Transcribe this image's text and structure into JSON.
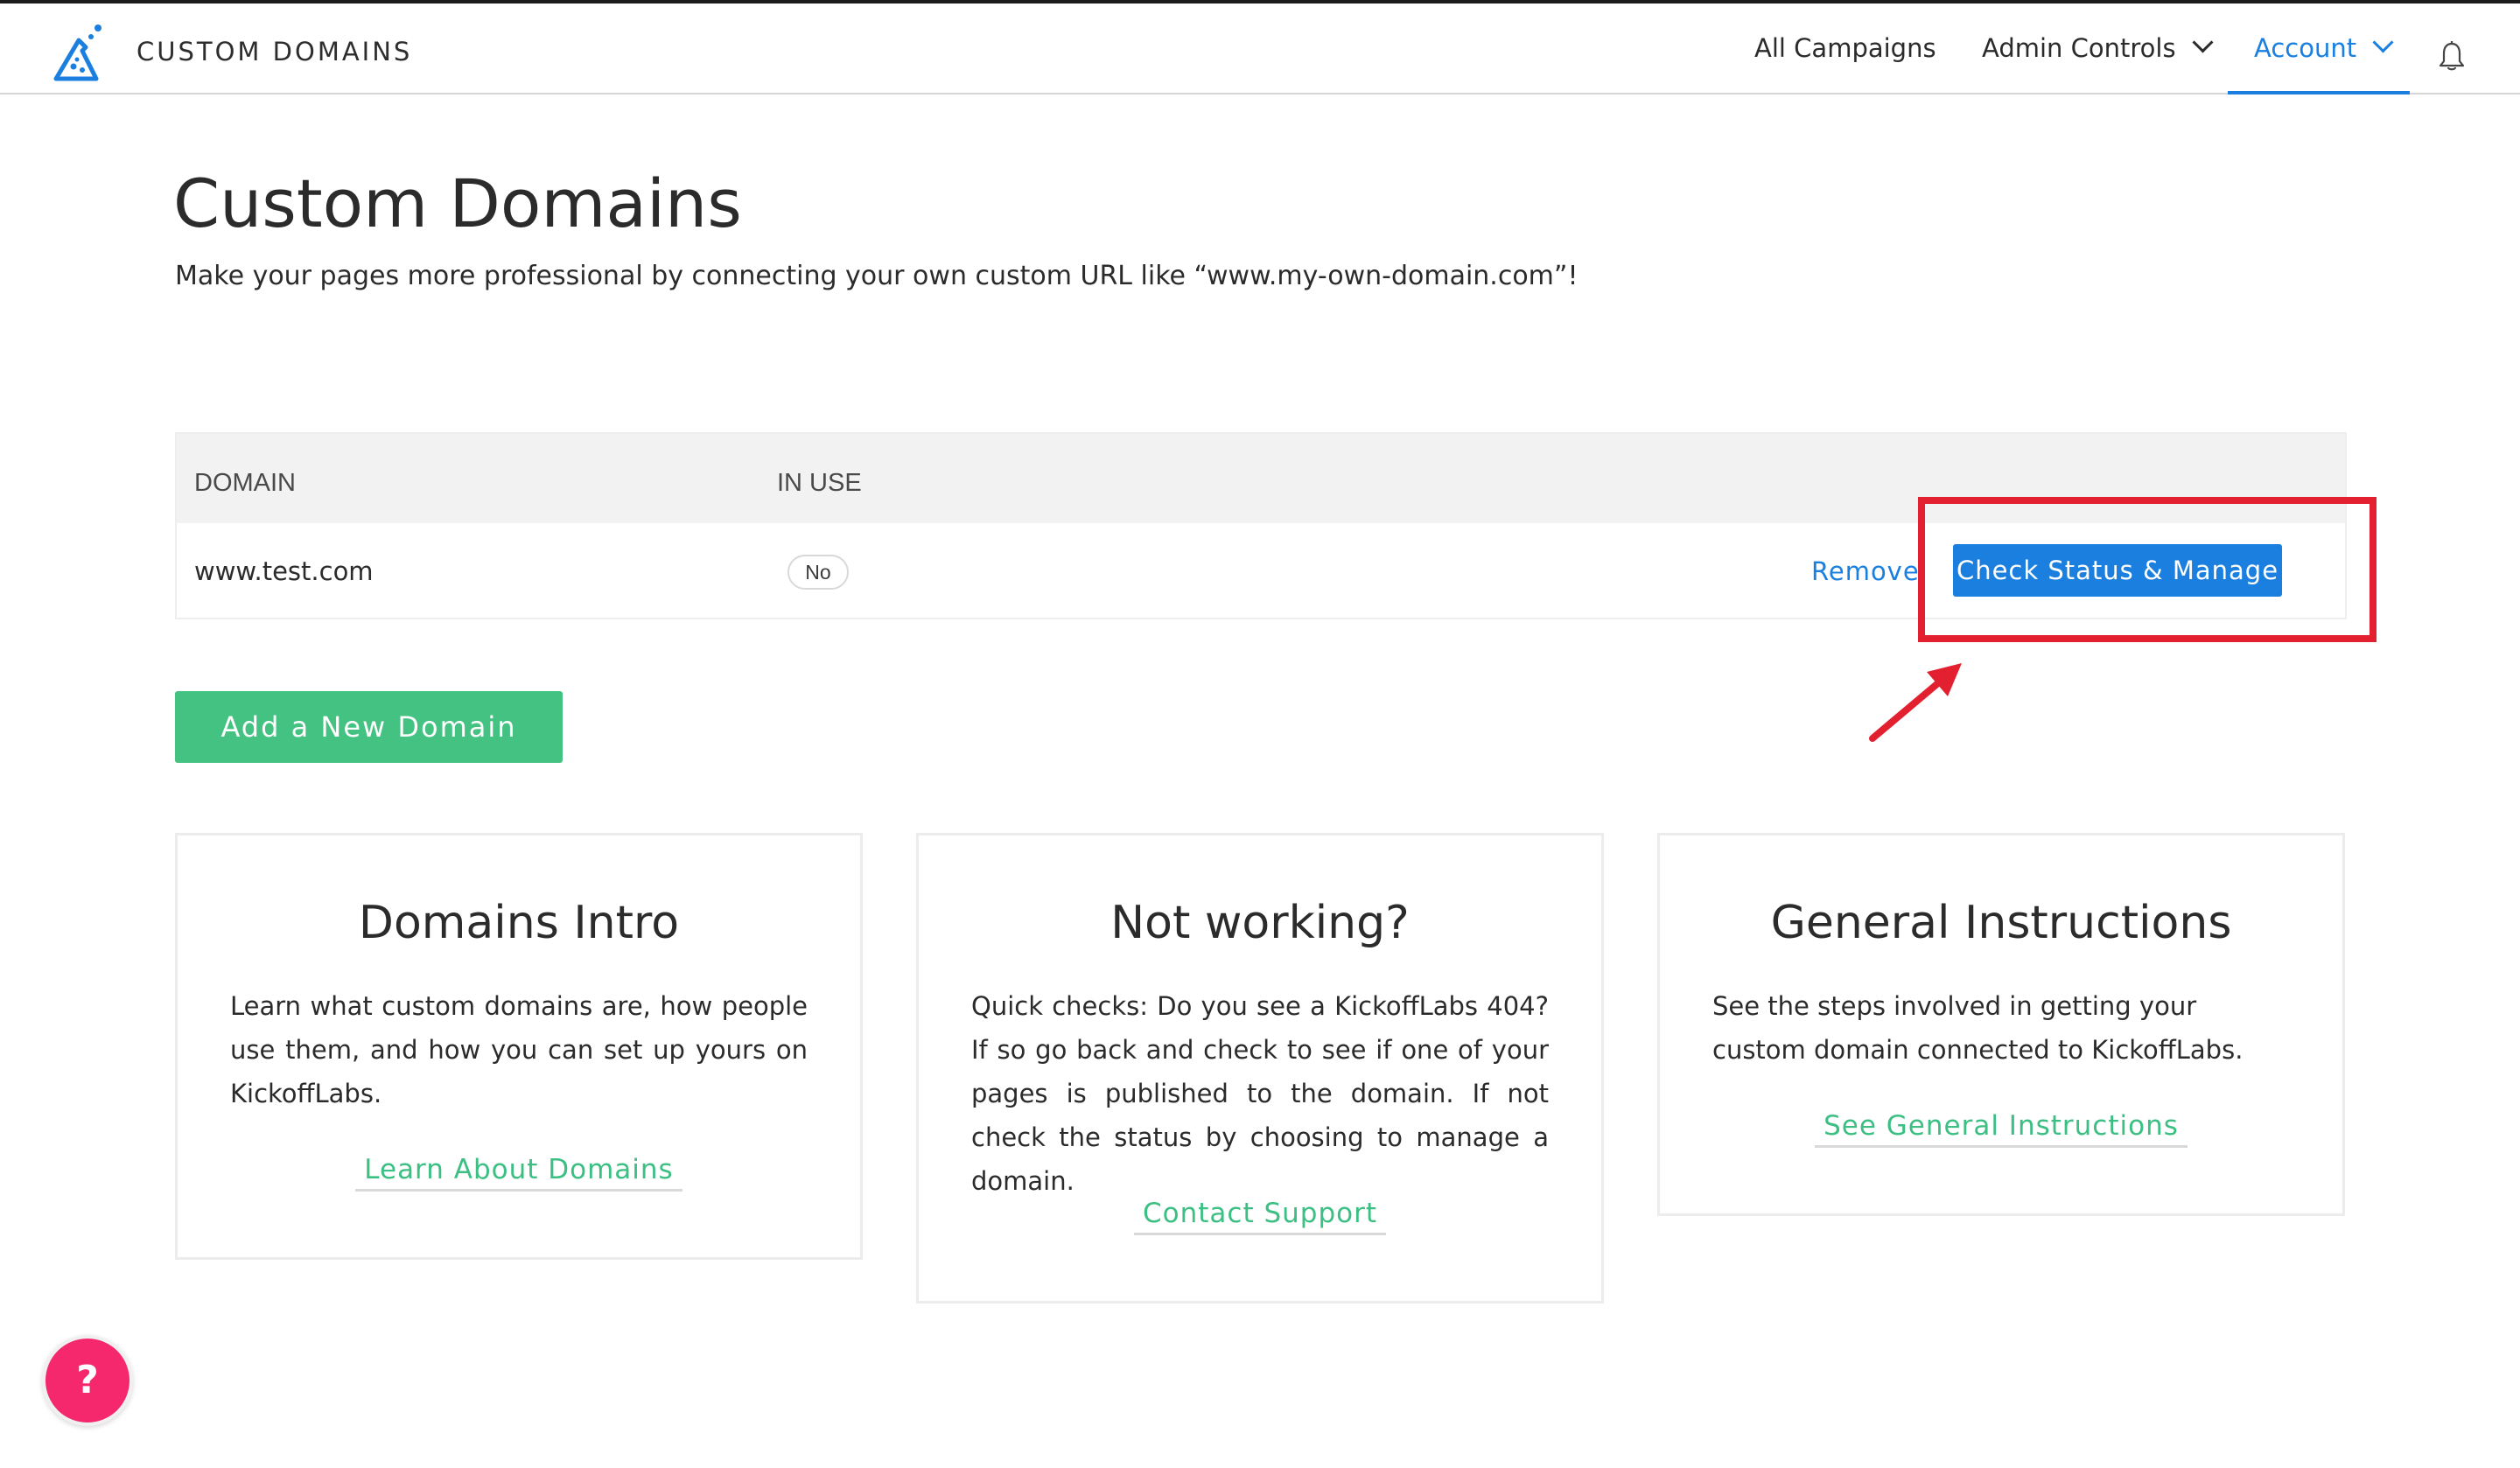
{
  "header": {
    "brand": "CUSTOM DOMAINS",
    "nav": {
      "all_campaigns": "All Campaigns",
      "admin_controls": "Admin Controls",
      "account": "Account"
    },
    "icons": [
      "flask-logo-icon",
      "chevron-down-icon",
      "bell-icon"
    ],
    "active_color": "#1b7fe0"
  },
  "page": {
    "title": "Custom Domains",
    "subtitle": "Make your pages more professional by connecting your own custom URL like “www.my-own-domain.com”!"
  },
  "table": {
    "columns": [
      "DOMAIN",
      "IN USE"
    ],
    "rows": [
      {
        "domain": "www.test.com",
        "in_use": "No",
        "remove_label": "Remove",
        "manage_label": "Check Status & Manage"
      }
    ]
  },
  "actions": {
    "add_domain": "Add a New Domain"
  },
  "cards": [
    {
      "title": "Domains Intro",
      "body": "Learn what custom domains are, how people use them, and how you can set up yours on KickoffLabs.",
      "link": "Learn About Domains"
    },
    {
      "title": "Not working?",
      "body": "Quick checks: Do you see a KickoffLabs 404? If so go back and check to see if one of your pages is published to the domain. If not check the status by choosing to manage a domain.",
      "link": "Contact Support"
    },
    {
      "title": "General Instructions",
      "body": "See the steps involved in getting your custom domain connected to KickoffLabs.",
      "link": "See General Instructions"
    }
  ],
  "help": {
    "label": "?",
    "color": "#f5276d"
  },
  "colors": {
    "primary": "#1b7fe0",
    "success": "#44c281",
    "annotation": "#e3202f"
  }
}
